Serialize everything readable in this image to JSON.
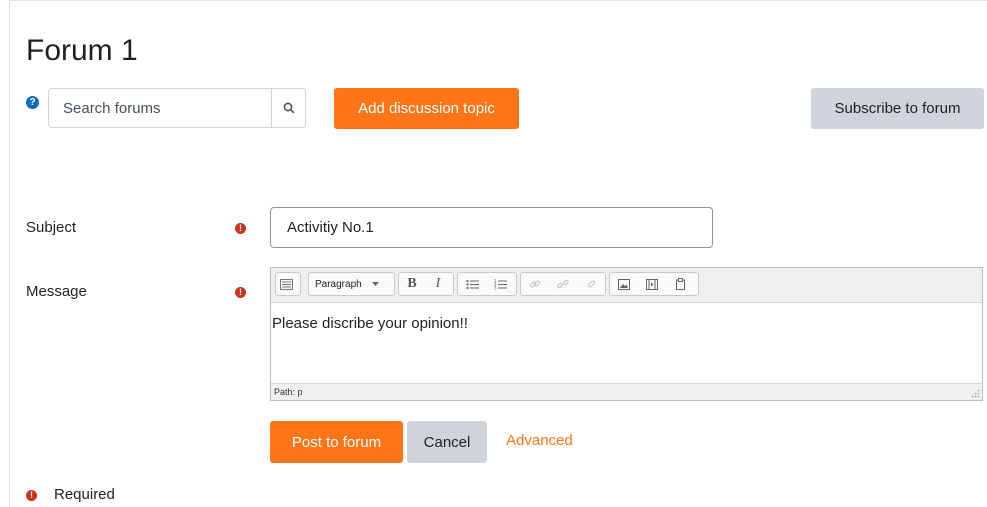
{
  "forum": {
    "title": "Forum 1"
  },
  "search": {
    "placeholder": "Search forums"
  },
  "actions": {
    "add_topic": "Add discussion topic",
    "subscribe": "Subscribe to forum"
  },
  "form": {
    "subject": {
      "label": "Subject",
      "value": "Activitiy No.1"
    },
    "message": {
      "label": "Message",
      "paragraph_format": "Paragraph",
      "content": "Please discribe your opinion!!",
      "path": "Path: p"
    },
    "buttons": {
      "post": "Post to forum",
      "cancel": "Cancel",
      "advanced": "Advanced"
    },
    "required_legend": "Required"
  },
  "colors": {
    "accent": "#ff7518",
    "required": "#ca3120",
    "help": "#0f6cbf",
    "secondary": "#ced4da"
  },
  "icons": [
    "help-icon",
    "search-icon",
    "required-icon",
    "toolbar-toggle-icon",
    "bold-icon",
    "italic-icon",
    "unordered-list-icon",
    "ordered-list-icon",
    "link-icon",
    "unlink-icon",
    "anchor-icon",
    "image-icon",
    "media-icon",
    "manage-files-icon",
    "resize-grip-icon"
  ]
}
